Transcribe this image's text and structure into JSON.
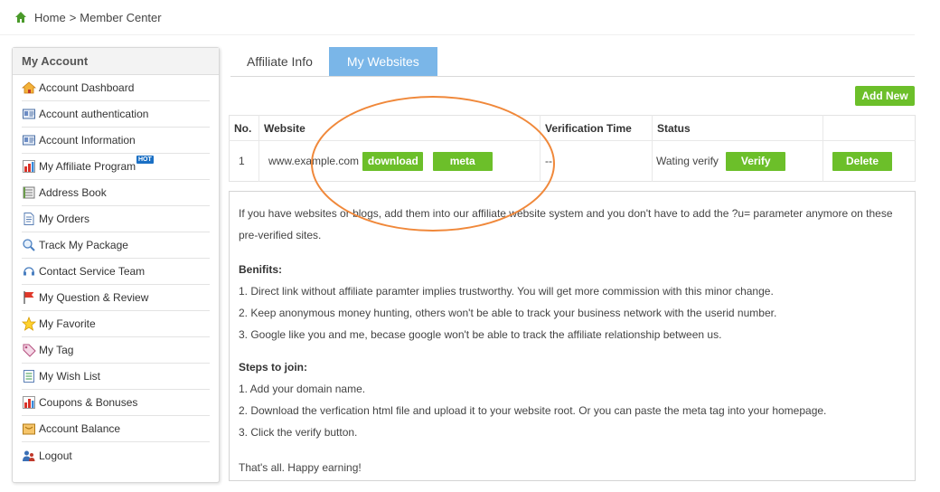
{
  "breadcrumb": {
    "home": "Home",
    "separator": ">",
    "current": "Member Center"
  },
  "sidebar": {
    "title": "My Account",
    "items": [
      {
        "label": "Account Dashboard",
        "icon": "house-icon"
      },
      {
        "label": "Account authentication",
        "icon": "id-card-icon"
      },
      {
        "label": "Account Information",
        "icon": "id-card-icon"
      },
      {
        "label": "My Affiliate Program",
        "icon": "chart-icon",
        "badge": "HOT"
      },
      {
        "label": "Address Book",
        "icon": "address-book-icon"
      },
      {
        "label": "My Orders",
        "icon": "document-icon"
      },
      {
        "label": "Track My Package",
        "icon": "search-package-icon"
      },
      {
        "label": "Contact Service Team",
        "icon": "headset-icon"
      },
      {
        "label": "My Question & Review",
        "icon": "flag-icon"
      },
      {
        "label": "My Favorite",
        "icon": "star-icon"
      },
      {
        "label": "My Tag",
        "icon": "tag-icon"
      },
      {
        "label": "My Wish List",
        "icon": "list-icon"
      },
      {
        "label": "Coupons & Bonuses",
        "icon": "coupon-icon"
      },
      {
        "label": "Account Balance",
        "icon": "wallet-icon"
      },
      {
        "label": "Logout",
        "icon": "users-icon"
      }
    ]
  },
  "tabs": [
    {
      "label": "Affiliate Info",
      "active": false
    },
    {
      "label": "My Websites",
      "active": true
    }
  ],
  "add_new_label": "Add New",
  "table": {
    "headers": [
      "No.",
      "Website",
      "Verification Time",
      "Status",
      ""
    ],
    "rows": [
      {
        "no": "1",
        "website": "www.example.com",
        "download_label": "download",
        "meta_label": "meta",
        "verification_time": "--",
        "status": "Wating verify",
        "verify_label": "Verify",
        "delete_label": "Delete"
      }
    ]
  },
  "info": {
    "intro": "If you have websites or blogs, add them into our affiliate website system and you don't have to add the ?u= parameter anymore on these pre-verified sites.",
    "benefits_title": "Benifits:",
    "benefits": [
      "1. Direct link without affiliate paramter implies trustworthy. You will get more commission with this minor change.",
      "2. Keep anonymous money hunting, others won't be able to track your business network with the userid number.",
      "3. Google like you and me, becase google won't be able to track the affiliate relationship between us."
    ],
    "steps_title": "Steps to join:",
    "steps": [
      "1. Add your domain name.",
      "2. Download the verfication html file and upload it to your website root. Or you can paste the meta tag into your homepage.",
      "3. Click the verify button."
    ],
    "closing": "That's all. Happy earning!"
  },
  "colors": {
    "accent_green": "#6cbf2a",
    "tab_active": "#7ab6e8",
    "annotation": "#f0883a"
  }
}
